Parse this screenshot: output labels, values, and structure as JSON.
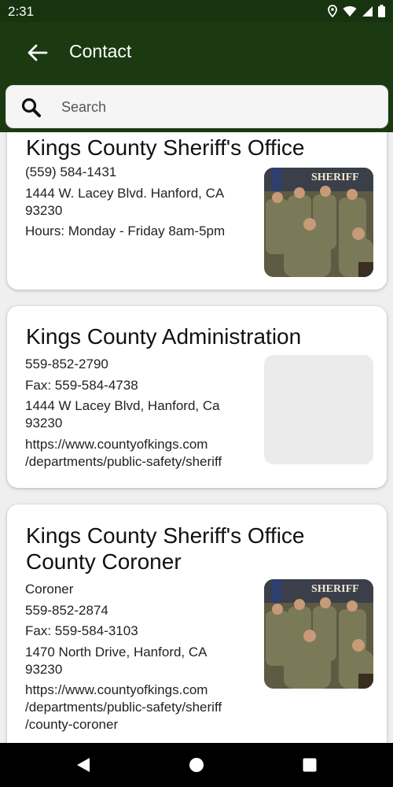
{
  "status": {
    "time": "2:31"
  },
  "header": {
    "title": "Contact"
  },
  "search": {
    "placeholder": "Search"
  },
  "cards": [
    {
      "title": "Kings County Sheriff's Office",
      "lines": [
        "(559) 584-1431",
        "1444 W. Lacey Blvd. Hanford, CA",
        "93230",
        "Hours: Monday - Friday 8am-5pm"
      ],
      "image": "sheriff-group-photo",
      "image_text": "SHERIFF"
    },
    {
      "title": "Kings County Administration",
      "lines": [
        "559-852-2790",
        "Fax: 559-584-4738",
        "1444 W Lacey Blvd, Hanford, Ca",
        "93230",
        "https://www.countyofkings.com",
        "/departments/public-safety/sheriff"
      ],
      "image": "placeholder"
    },
    {
      "title_lines": [
        "Kings County Sheriff's Office",
        "County Coroner"
      ],
      "lines": [
        "Coroner",
        "559-852-2874",
        "Fax: 559-584-3103",
        "1470 North Drive, Hanford, CA",
        "93230",
        "https://www.countyofkings.com",
        "/departments/public-safety/sheriff",
        "/county-coroner"
      ],
      "image": "sheriff-group-photo",
      "image_text": "SHERIFF"
    }
  ],
  "nav": {
    "back": "back-icon",
    "home": "home-icon",
    "recents": "recents-icon"
  }
}
